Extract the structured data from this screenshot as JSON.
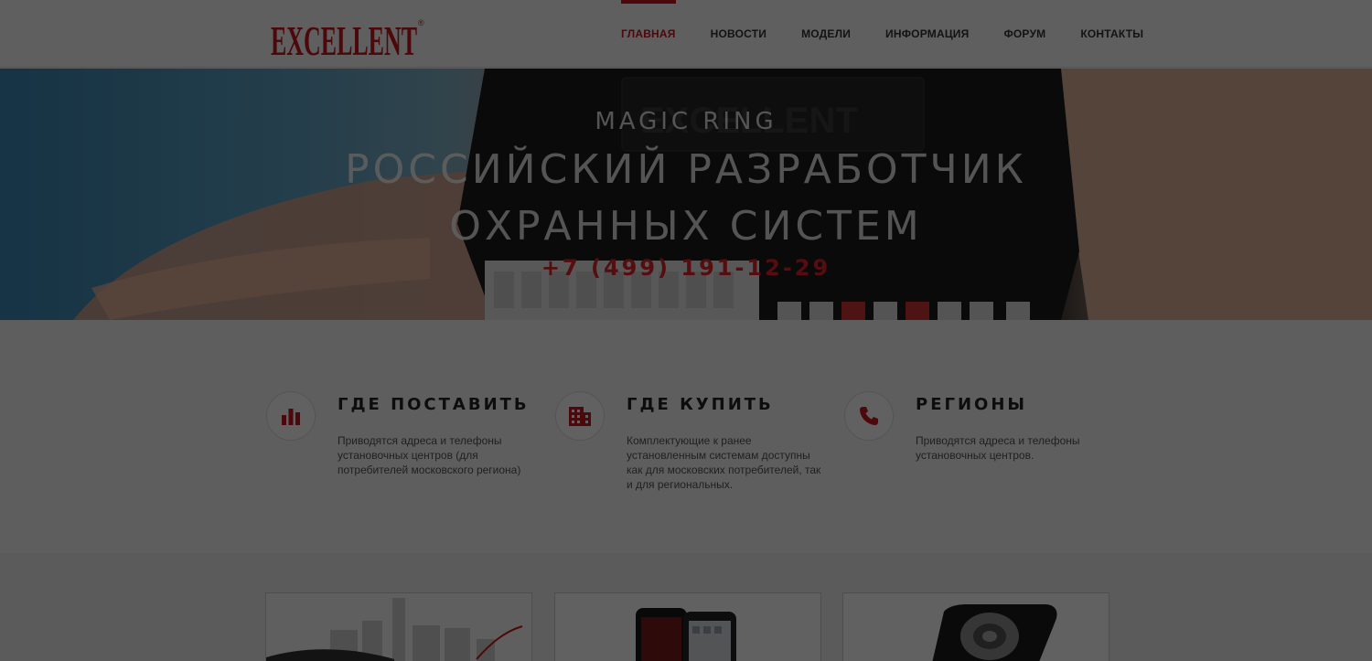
{
  "header": {
    "logo_text": "EXCELLENT",
    "nav": [
      {
        "label": "ГЛАВНАЯ",
        "active": true
      },
      {
        "label": "НОВОСТИ",
        "active": false
      },
      {
        "label": "МОДЕЛИ",
        "active": false
      },
      {
        "label": "ИНФОРМАЦИЯ",
        "active": false
      },
      {
        "label": "ФОРУМ",
        "active": false
      },
      {
        "label": "КОНТАКТЫ",
        "active": false
      }
    ]
  },
  "hero": {
    "subtitle": "MAGIC RING",
    "title_line1": "РОССИЙСКИЙ РАЗРАБОТЧИК",
    "title_line2": "ОХРАННЫХ СИСТЕМ",
    "phone": "+7 (499) 191-12-29"
  },
  "features": [
    {
      "icon": "bar-chart-icon",
      "title": "ГДЕ ПОСТАВИТЬ",
      "text": "Приводятся адреса и телефоны установочных центров (для потребителей московского региона)"
    },
    {
      "icon": "building-icon",
      "title": "ГДЕ КУПИТЬ",
      "text": "Комплектующие к ранее установленным системам доступны как для московских потребителей, так и для региональных."
    },
    {
      "icon": "phone-icon",
      "title": "РЕГИОНЫ",
      "text": "Приводятся адреса и телефоны установочных центров."
    }
  ],
  "colors": {
    "accent": "#c8161d",
    "overlay": "rgba(0,0,0,0.62)"
  }
}
